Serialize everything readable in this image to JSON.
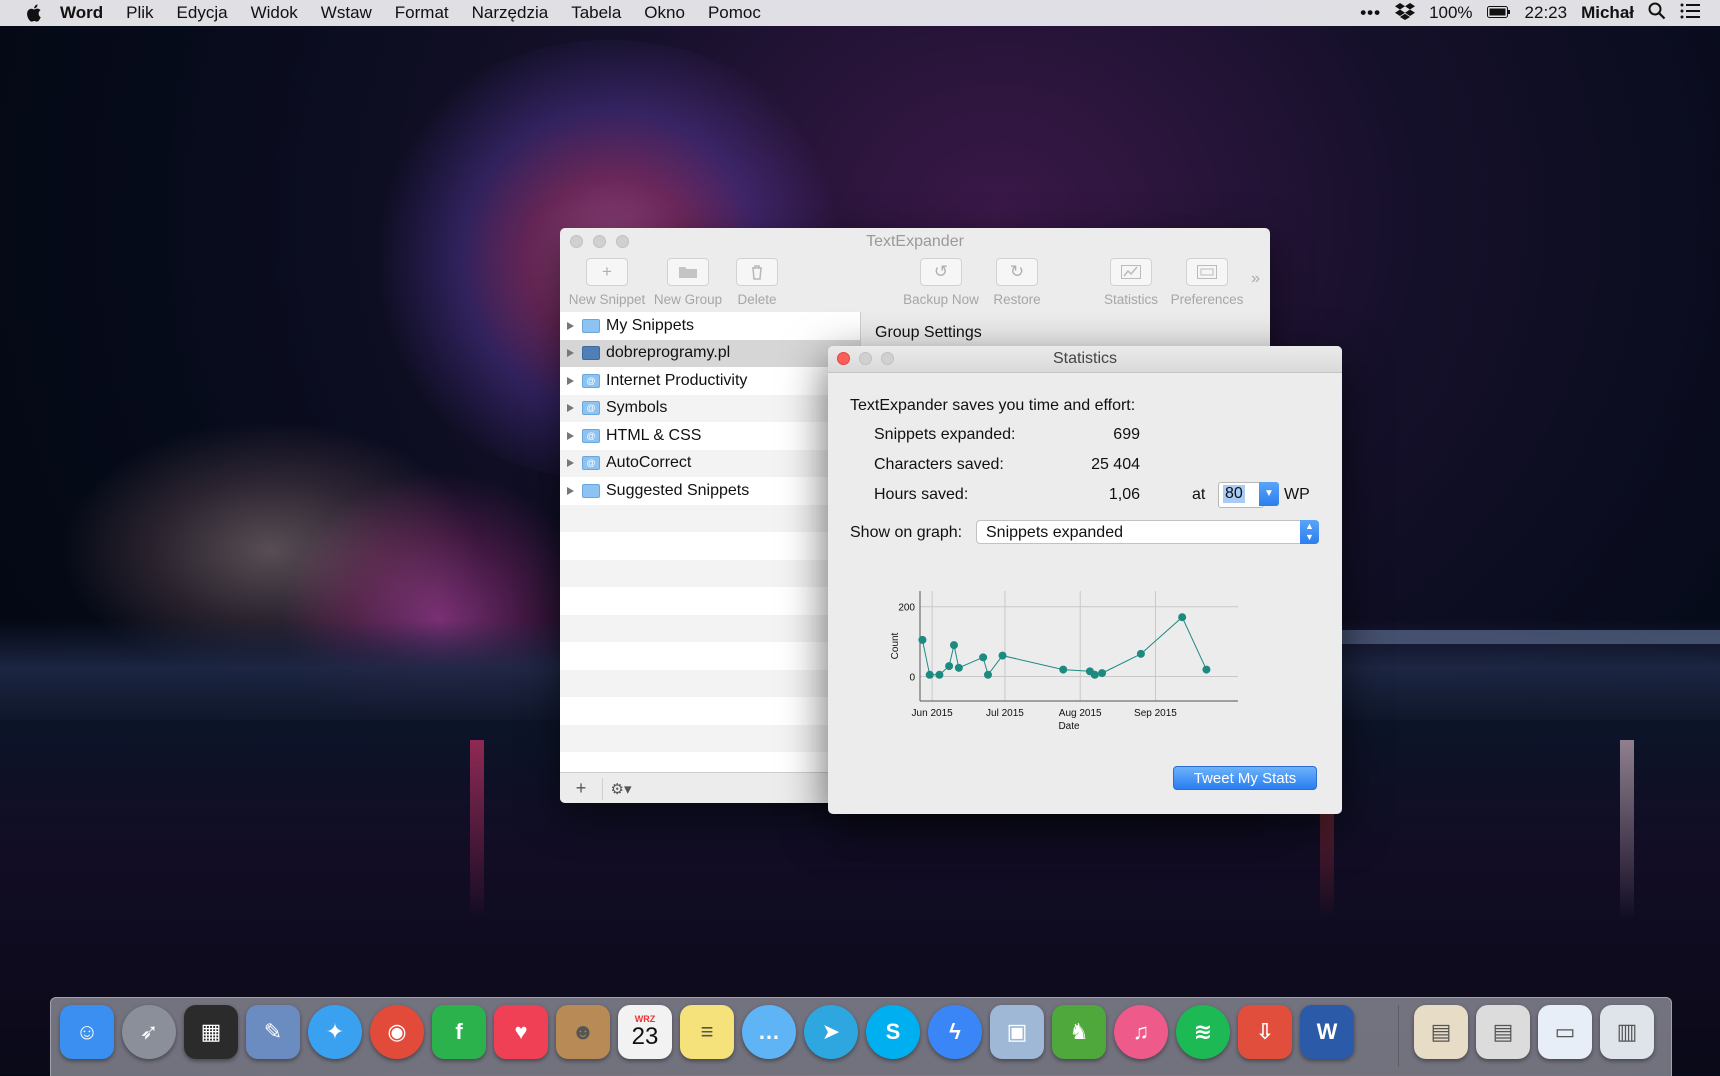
{
  "menubar": {
    "app": "Word",
    "items": [
      "Plik",
      "Edycja",
      "Widok",
      "Wstaw",
      "Format",
      "Narzędzia",
      "Tabela",
      "Okno",
      "Pomoc"
    ],
    "status": {
      "battery": "100%",
      "time": "22:23",
      "user": "Michał"
    }
  },
  "textexpander": {
    "title": "TextExpander",
    "toolbar": {
      "new_snippet": "New Snippet",
      "new_group": "New Group",
      "delete": "Delete",
      "backup_now": "Backup Now",
      "restore": "Restore",
      "statistics": "Statistics",
      "preferences": "Preferences",
      "more": "»"
    },
    "groups": [
      {
        "label": "My Snippets",
        "icon": "folder-icon"
      },
      {
        "label": "dobreprogramy.pl",
        "icon": "folder-icon",
        "selected": true
      },
      {
        "label": "Internet Productivity",
        "icon": "shared-folder-icon"
      },
      {
        "label": "Symbols",
        "icon": "shared-folder-icon"
      },
      {
        "label": "HTML & CSS",
        "icon": "shared-folder-icon"
      },
      {
        "label": "AutoCorrect",
        "icon": "shared-folder-icon"
      },
      {
        "label": "Suggested Snippets",
        "icon": "folder-icon"
      }
    ],
    "right_panel_title": "Group Settings"
  },
  "statistics": {
    "title": "Statistics",
    "intro": "TextExpander saves you time and effort:",
    "snippets_label": "Snippets expanded:",
    "snippets_value": "699",
    "characters_label": "Characters saved:",
    "characters_value": "25 404",
    "hours_label": "Hours saved:",
    "hours_value": "1,06",
    "at_label": "at",
    "wpm_value": "80",
    "wpm_unit": "WP",
    "graph_label": "Show on graph:",
    "graph_select": "Snippets expanded",
    "tweet_button": "Tweet My Stats"
  },
  "chart_data": {
    "type": "line",
    "xlabel": "Date",
    "ylabel": "Count",
    "x_ticks": [
      "Jun 2015",
      "Jul 2015",
      "Aug 2015",
      "Sep 2015"
    ],
    "y_ticks": [
      0,
      200
    ],
    "xlim": [
      "2015-05-27",
      "2015-10-05"
    ],
    "ylim": [
      -70,
      245
    ],
    "grid": true,
    "line_color": "#1d8a80",
    "series": [
      {
        "points": [
          [
            "2015-05-28",
            105
          ],
          [
            "2015-05-31",
            5
          ],
          [
            "2015-06-04",
            5
          ],
          [
            "2015-06-08",
            30
          ],
          [
            "2015-06-10",
            90
          ],
          [
            "2015-06-12",
            25
          ],
          [
            "2015-06-22",
            55
          ],
          [
            "2015-06-24",
            5
          ],
          [
            "2015-06-30",
            60
          ],
          [
            "2015-07-25",
            20
          ],
          [
            "2015-08-05",
            15
          ],
          [
            "2015-08-07",
            5
          ],
          [
            "2015-08-10",
            10
          ],
          [
            "2015-08-26",
            65
          ],
          [
            "2015-09-12",
            170
          ],
          [
            "2015-09-22",
            20
          ]
        ]
      }
    ]
  },
  "dock": {
    "apps": [
      {
        "name": "Finder",
        "icon": "finder-icon",
        "color": "#3a8ff0"
      },
      {
        "name": "Launchpad",
        "icon": "rocket-icon",
        "color": "#8a8f99"
      },
      {
        "name": "Mission Control",
        "icon": "mission-control-icon",
        "color": "#2b2b2b"
      },
      {
        "name": "Preview",
        "icon": "preview-icon",
        "color": "#6b8cc0"
      },
      {
        "name": "Safari",
        "icon": "compass-icon",
        "color": "#3aa0f0"
      },
      {
        "name": "Chrome",
        "icon": "chrome-icon",
        "color": "#e24b3a"
      },
      {
        "name": "Feedly",
        "icon": "feedly-icon",
        "color": "#2bb24c"
      },
      {
        "name": "Pocket",
        "icon": "pocket-icon",
        "color": "#ef4056"
      },
      {
        "name": "Contacts",
        "icon": "contacts-icon",
        "color": "#b88a55"
      },
      {
        "name": "Calendar",
        "icon": "calendar-icon",
        "color": "#f2f2f2",
        "month": "WRZ",
        "day": "23"
      },
      {
        "name": "Notes",
        "icon": "notes-icon",
        "color": "#f5e27a"
      },
      {
        "name": "Messages",
        "icon": "speech-bubble-icon",
        "color": "#5fb4f5"
      },
      {
        "name": "Telegram",
        "icon": "paper-plane-icon",
        "color": "#2ea6df"
      },
      {
        "name": "Skype",
        "icon": "skype-icon",
        "color": "#00aff0"
      },
      {
        "name": "Messenger",
        "icon": "messenger-icon",
        "color": "#3b86f7"
      },
      {
        "name": "Preview 2",
        "icon": "photo-icon",
        "color": "#9fb8d6"
      },
      {
        "name": "Evernote",
        "icon": "evernote-icon",
        "color": "#4fa83c"
      },
      {
        "name": "iTunes",
        "icon": "music-note-icon",
        "color": "#ee5a8a"
      },
      {
        "name": "Spotify",
        "icon": "spotify-icon",
        "color": "#1db954"
      },
      {
        "name": "Downloader",
        "icon": "download-icon",
        "color": "#e24e3c"
      },
      {
        "name": "Word",
        "icon": "word-icon",
        "color": "#2b5aa8"
      }
    ],
    "right_items": [
      {
        "name": "Documents stack",
        "icon": "stack-icon",
        "color": "#e7dcc5"
      },
      {
        "name": "Downloads stack",
        "icon": "stack-icon",
        "color": "#dcdcdc"
      },
      {
        "name": "Word document",
        "icon": "document-icon",
        "color": "#e8eef7"
      },
      {
        "name": "Trash",
        "icon": "trash-icon",
        "color": "#dfe4ea"
      }
    ]
  }
}
